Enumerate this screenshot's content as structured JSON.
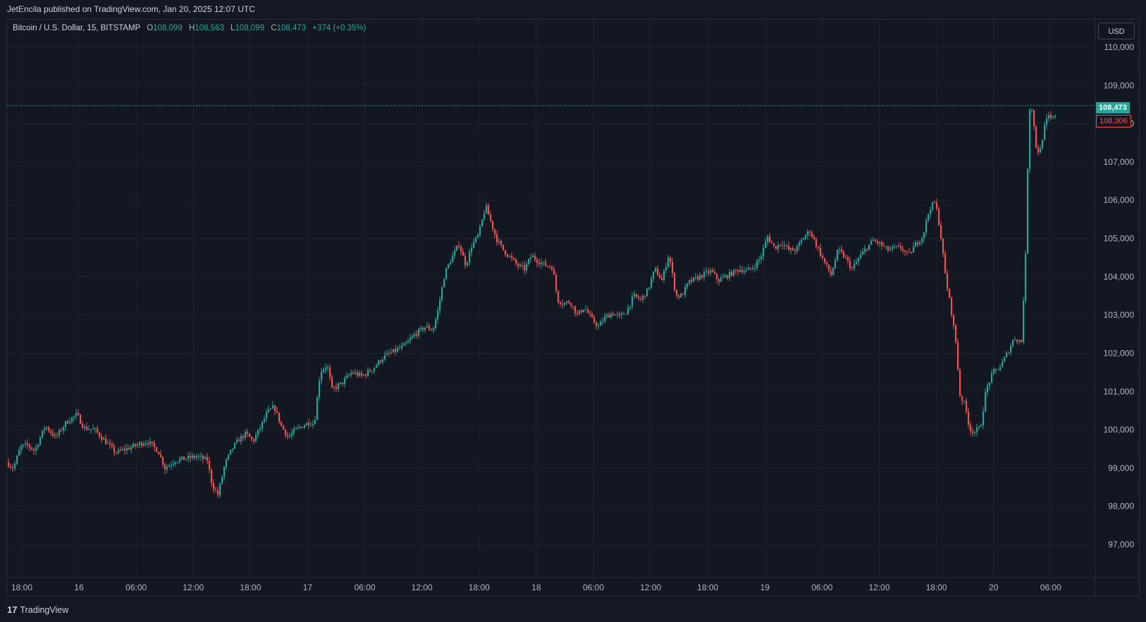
{
  "header": {
    "caption": "JetEncila published on TradingView.com, Jan 20, 2025 12:07 UTC"
  },
  "legend": {
    "symbol": "Bitcoin / U.S. Dollar, 15, BITSTAMP",
    "open_label": "O",
    "open": "108,099",
    "high_label": "H",
    "high": "108,563",
    "low_label": "L",
    "low": "108,099",
    "close_label": "C",
    "close": "108,473",
    "change": "+374 (+0.35%)"
  },
  "currency_button": "USD",
  "footer": {
    "logo_text": "TradingView",
    "logo_mark": "17"
  },
  "colors": {
    "up": "#26a69a",
    "down": "#ef5350",
    "background": "#131722",
    "grid": "#1e222d"
  },
  "chart_data": {
    "type": "candlestick",
    "interval": "15",
    "y_ticks": [
      "110,000",
      "109,000",
      "108,000",
      "107,000",
      "106,000",
      "105,000",
      "104,000",
      "103,000",
      "102,000",
      "101,000",
      "100,000",
      "99,000",
      "98,000",
      "97,000"
    ],
    "x_ticks": [
      "18:00",
      "16",
      "06:00",
      "12:00",
      "18:00",
      "17",
      "06:00",
      "12:00",
      "18:00",
      "18",
      "06:00",
      "12:00",
      "18:00",
      "19",
      "06:00",
      "12:00",
      "18:00",
      "20",
      "06:00"
    ],
    "ylim": [
      96200,
      110600
    ],
    "last_price": 108473,
    "last_price_label": "108,473",
    "second_price_label": "108,306",
    "price_path": [
      [
        0,
        99150
      ],
      [
        10,
        99000
      ],
      [
        20,
        99550
      ],
      [
        30,
        99600
      ],
      [
        40,
        99450
      ],
      [
        55,
        100100
      ],
      [
        70,
        99800
      ],
      [
        85,
        100200
      ],
      [
        100,
        100400
      ],
      [
        110,
        100050
      ],
      [
        125,
        100000
      ],
      [
        140,
        99700
      ],
      [
        155,
        99400
      ],
      [
        170,
        99500
      ],
      [
        185,
        99600
      ],
      [
        200,
        99700
      ],
      [
        215,
        99450
      ],
      [
        225,
        99000
      ],
      [
        240,
        99200
      ],
      [
        255,
        99250
      ],
      [
        270,
        99300
      ],
      [
        285,
        99200
      ],
      [
        292,
        98550
      ],
      [
        300,
        98300
      ],
      [
        310,
        99100
      ],
      [
        320,
        99500
      ],
      [
        330,
        99750
      ],
      [
        340,
        99900
      ],
      [
        350,
        99700
      ],
      [
        360,
        100050
      ],
      [
        370,
        100450
      ],
      [
        380,
        100600
      ],
      [
        390,
        100100
      ],
      [
        400,
        99800
      ],
      [
        410,
        100000
      ],
      [
        420,
        100100
      ],
      [
        430,
        100200
      ],
      [
        437,
        100150
      ],
      [
        445,
        101500
      ],
      [
        455,
        101700
      ],
      [
        462,
        101050
      ],
      [
        475,
        101200
      ],
      [
        490,
        101500
      ],
      [
        505,
        101400
      ],
      [
        520,
        101600
      ],
      [
        535,
        101900
      ],
      [
        550,
        102050
      ],
      [
        565,
        102200
      ],
      [
        580,
        102500
      ],
      [
        595,
        102700
      ],
      [
        605,
        102600
      ],
      [
        612,
        103100
      ],
      [
        622,
        104100
      ],
      [
        632,
        104500
      ],
      [
        642,
        104850
      ],
      [
        652,
        104300
      ],
      [
        660,
        104800
      ],
      [
        670,
        105100
      ],
      [
        680,
        105850
      ],
      [
        688,
        105400
      ],
      [
        695,
        105000
      ],
      [
        705,
        104700
      ],
      [
        715,
        104500
      ],
      [
        725,
        104300
      ],
      [
        735,
        104200
      ],
      [
        745,
        104550
      ],
      [
        755,
        104400
      ],
      [
        765,
        104300
      ],
      [
        775,
        104250
      ],
      [
        782,
        103400
      ],
      [
        790,
        103300
      ],
      [
        800,
        103350
      ],
      [
        810,
        103000
      ],
      [
        820,
        103200
      ],
      [
        830,
        102900
      ],
      [
        840,
        102700
      ],
      [
        850,
        102950
      ],
      [
        860,
        103050
      ],
      [
        870,
        102950
      ],
      [
        880,
        103100
      ],
      [
        890,
        103500
      ],
      [
        900,
        103400
      ],
      [
        910,
        103650
      ],
      [
        920,
        104200
      ],
      [
        930,
        103900
      ],
      [
        940,
        104600
      ],
      [
        950,
        103500
      ],
      [
        958,
        103500
      ],
      [
        968,
        103850
      ],
      [
        978,
        103950
      ],
      [
        988,
        104050
      ],
      [
        1000,
        104150
      ],
      [
        1010,
        103900
      ],
      [
        1020,
        104000
      ],
      [
        1030,
        104100
      ],
      [
        1040,
        104200
      ],
      [
        1050,
        104150
      ],
      [
        1060,
        104250
      ],
      [
        1070,
        104500
      ],
      [
        1080,
        105050
      ],
      [
        1090,
        104750
      ],
      [
        1100,
        104900
      ],
      [
        1110,
        104700
      ],
      [
        1120,
        104700
      ],
      [
        1130,
        105000
      ],
      [
        1140,
        105200
      ],
      [
        1150,
        104800
      ],
      [
        1160,
        104400
      ],
      [
        1170,
        104050
      ],
      [
        1180,
        104700
      ],
      [
        1190,
        104500
      ],
      [
        1200,
        104200
      ],
      [
        1210,
        104500
      ],
      [
        1220,
        104750
      ],
      [
        1230,
        104950
      ],
      [
        1240,
        104850
      ],
      [
        1250,
        104700
      ],
      [
        1260,
        104750
      ],
      [
        1270,
        104750
      ],
      [
        1280,
        104550
      ],
      [
        1290,
        104850
      ],
      [
        1300,
        105050
      ],
      [
        1310,
        105800
      ],
      [
        1318,
        105950
      ],
      [
        1325,
        105200
      ],
      [
        1333,
        103900
      ],
      [
        1340,
        103200
      ],
      [
        1347,
        102300
      ],
      [
        1353,
        100900
      ],
      [
        1360,
        100650
      ],
      [
        1367,
        100000
      ],
      [
        1374,
        99950
      ],
      [
        1382,
        100050
      ],
      [
        1390,
        101050
      ],
      [
        1400,
        101500
      ],
      [
        1410,
        101650
      ],
      [
        1420,
        102000
      ],
      [
        1430,
        102400
      ],
      [
        1440,
        102300
      ],
      [
        1446,
        104550
      ],
      [
        1451,
        108400
      ],
      [
        1456,
        108400
      ],
      [
        1460,
        107450
      ],
      [
        1466,
        107200
      ],
      [
        1472,
        107850
      ],
      [
        1478,
        108200
      ],
      [
        1484,
        108100
      ],
      [
        1490,
        108300
      ],
      [
        1496,
        108473
      ]
    ]
  }
}
